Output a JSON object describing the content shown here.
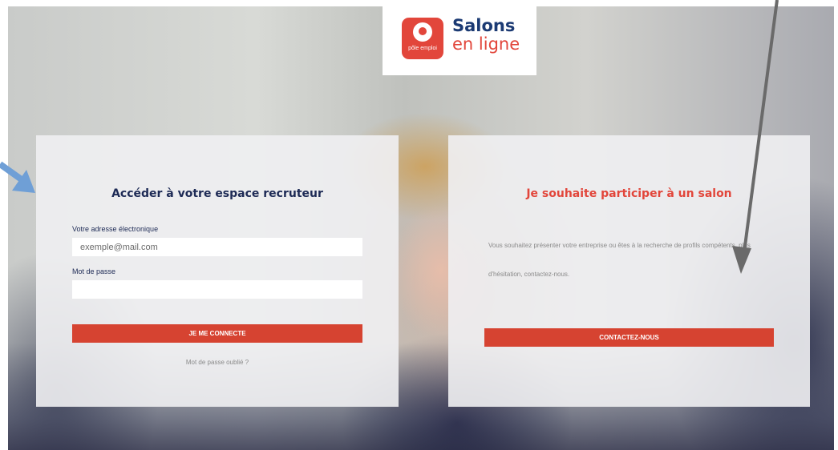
{
  "logo": {
    "badge_sub": "pôle emploi",
    "title_line1": "Salons",
    "title_line2": "en ligne"
  },
  "login_panel": {
    "title": "Accéder à votre espace recruteur",
    "email_label": "Votre adresse électronique",
    "email_placeholder": "exemple@mail.com",
    "password_label": "Mot de passe",
    "password_value": "",
    "submit_label": "JE ME CONNECTE",
    "forgot_link": "Mot de passe oublié ?"
  },
  "contact_panel": {
    "title": "Je souhaite participer à un salon",
    "description": "Vous souhaitez présenter votre entreprise ou êtes à la recherche de profils compétents, plus d'hésitation, contactez-nous.",
    "button_label": "CONTACTEZ-NOUS"
  },
  "colors": {
    "brand_red": "#e2463b",
    "button_red": "#d64331",
    "navy": "#1d2a55",
    "annotation_blue": "#6f9fd6",
    "annotation_gray": "#6a6a6a"
  }
}
